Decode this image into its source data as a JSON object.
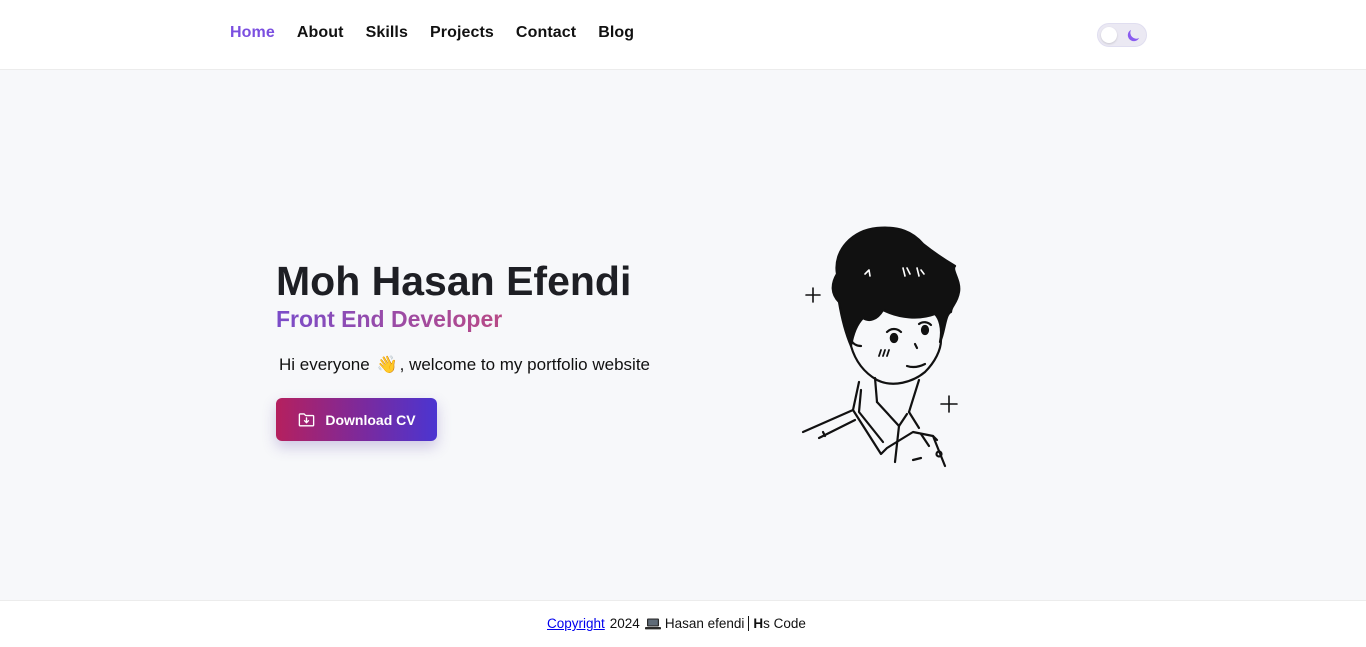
{
  "nav": {
    "items": [
      {
        "label": "Home",
        "active": true
      },
      {
        "label": "About",
        "active": false
      },
      {
        "label": "Skills",
        "active": false
      },
      {
        "label": "Projects",
        "active": false
      },
      {
        "label": "Contact",
        "active": false
      },
      {
        "label": "Blog",
        "active": false
      }
    ],
    "theme_toggle": {
      "icon": "moon-icon",
      "state": "light"
    }
  },
  "hero": {
    "name": "Moh Hasan Efendi",
    "role": "Front End Developer",
    "greeting_before": "Hi everyone",
    "greeting_emoji": "👋",
    "greeting_after": ", welcome to my portfolio website",
    "download_label": "Download CV"
  },
  "footer": {
    "copyright_label": "Copyright",
    "year": "2024",
    "author": "Hasan efendi",
    "brand_initial": "H",
    "brand_rest": "s Code"
  },
  "colors": {
    "accent": "#7b4fe0",
    "hero_bg": "#f7f8fa",
    "button_gradient_start": "#b5205e",
    "button_gradient_end": "#4b35d1"
  }
}
